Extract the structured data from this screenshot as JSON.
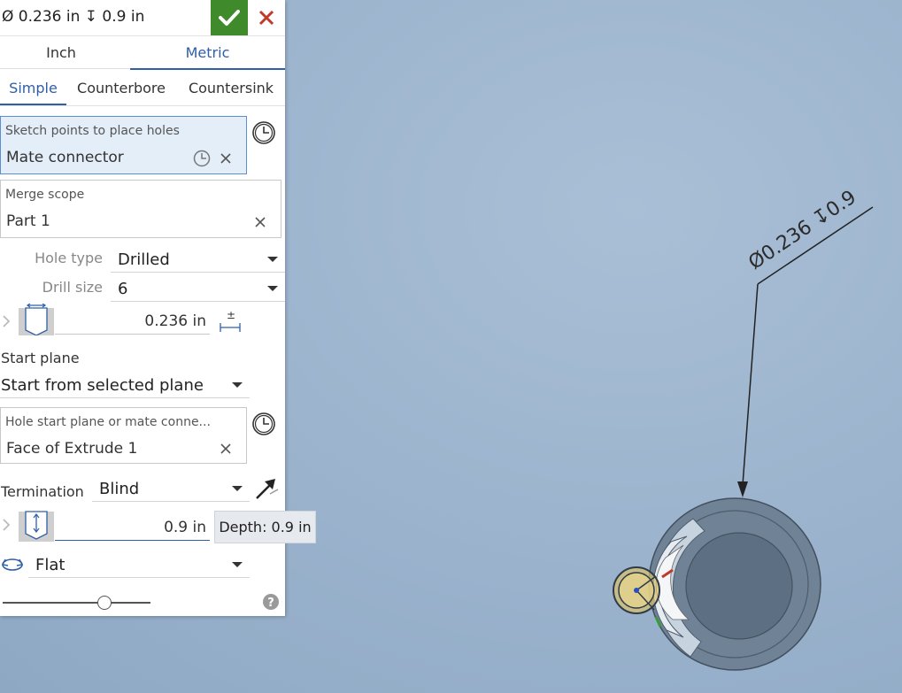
{
  "header": {
    "title": "Ø 0.236 in ↧ 0.9 in",
    "accept_icon": "checkmark-icon",
    "cancel_icon": "close-icon",
    "accept_color": "#3f8a2b",
    "cancel_color": "#c0392b"
  },
  "unit_tabs": [
    {
      "label": "Inch",
      "active": false
    },
    {
      "label": "Metric",
      "active": true
    }
  ],
  "style_tabs": [
    {
      "label": "Simple",
      "active": true
    },
    {
      "label": "Counterbore",
      "active": false
    },
    {
      "label": "Countersink",
      "active": false
    }
  ],
  "sketch_points": {
    "label": "Sketch points to place holes",
    "value": "Mate connector"
  },
  "merge_scope": {
    "label": "Merge scope",
    "value": "Part 1"
  },
  "hole_type": {
    "label": "Hole type",
    "value": "Drilled"
  },
  "drill_size": {
    "label": "Drill size",
    "value": "6"
  },
  "diameter": {
    "value": "0.236 in",
    "icon": "hole-diameter-icon",
    "tolerance_icon": "tolerance-icon"
  },
  "start_plane": {
    "label": "Start plane",
    "value": "Start from selected plane"
  },
  "hole_start": {
    "label": "Hole start plane or mate conne...",
    "value": "Face of Extrude 1"
  },
  "termination": {
    "label": "Termination",
    "value": "Blind",
    "icon": "direction-arrow-icon"
  },
  "depth": {
    "value": "0.9 in",
    "icon": "hole-depth-icon",
    "tooltip": "Depth: 0.9 in"
  },
  "tip": {
    "value": "Flat",
    "icon": "flip-direction-icon"
  },
  "slider": {
    "level": 0.67
  },
  "help_icon": "help-icon",
  "viewport": {
    "callout": "Ø0.236 ↧0.9",
    "accent_colors": {
      "red_axis": "#c0392b",
      "green_axis": "#3a9a3a",
      "blue_axis": "#2a4fc0",
      "connector": "#d8c06a"
    }
  }
}
